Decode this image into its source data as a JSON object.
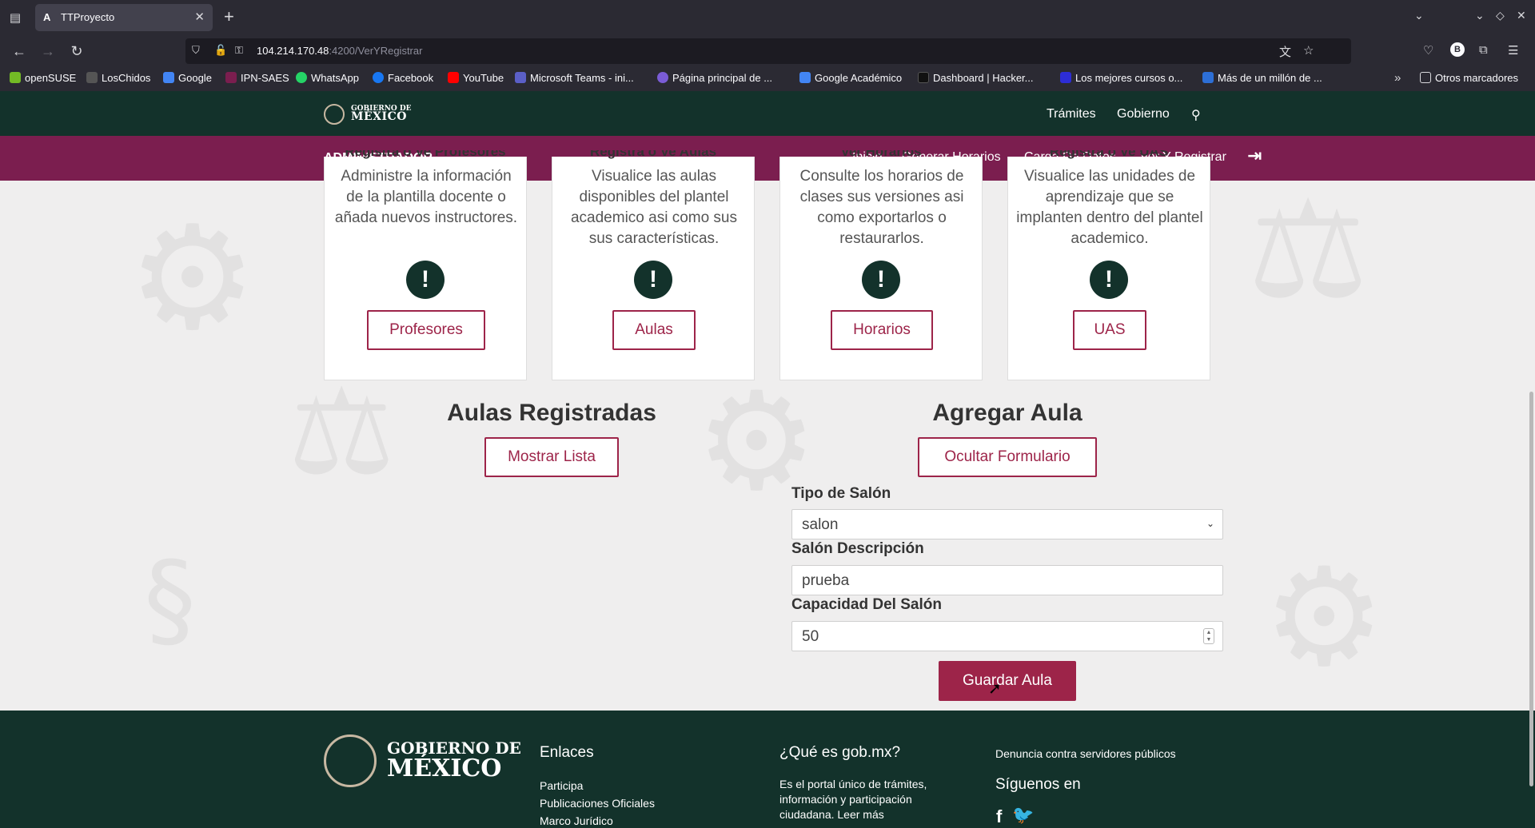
{
  "browser": {
    "tab_title": "TTProyecto",
    "tab_favicon": "A",
    "url_host": "104.214.170.48",
    "url_path": ":4200/VerYRegistrar",
    "bookmarks": [
      {
        "label": "openSUSE",
        "color": "#73ba25"
      },
      {
        "label": "LosChidos",
        "color": "#555555"
      },
      {
        "label": "Google",
        "color": "#4285f4"
      },
      {
        "label": "IPN-SAES",
        "color": "#7b1e4f"
      },
      {
        "label": "WhatsApp",
        "color": "#25d366"
      },
      {
        "label": "Facebook",
        "color": "#1877f2"
      },
      {
        "label": "YouTube",
        "color": "#ff0000"
      },
      {
        "label": "Microsoft Teams - ini...",
        "color": "#5b5fc7"
      },
      {
        "label": "Página principal de ...",
        "color": "#7a5cd6"
      },
      {
        "label": "Google Académico",
        "color": "#4285f4"
      },
      {
        "label": "Dashboard | Hacker...",
        "color": "#111111"
      },
      {
        "label": "Los mejores cursos o...",
        "color": "#2d2dd6"
      },
      {
        "label": "Más de un millón de ...",
        "color": "#2d6fd6"
      }
    ],
    "other_bookmarks": "Otros marcadores"
  },
  "gov_header": {
    "logo_small": "GOBIERNO DE",
    "logo_big": "MÉXICO",
    "nav": [
      "Trámites",
      "Gobierno"
    ]
  },
  "admin_bar": {
    "title": "ADMINISTRADOR",
    "nav": [
      "Inicio",
      "Generar Horarios",
      "Carga De Datos",
      "Ver Y Registrar"
    ]
  },
  "cards": [
    {
      "title": "Registra o Ve Profesores",
      "text": "Administre la información de la plantilla docente o añada nuevos instructores.",
      "button": "Profesores"
    },
    {
      "title": "Registra o Ve Aulas",
      "text": "Visualice las aulas disponibles del plantel academico asi como sus sus características.",
      "button": "Aulas"
    },
    {
      "title": "Ver Horarios",
      "text": "Consulte los horarios de clases sus versiones asi como exportarlos o restaurarlos.",
      "button": "Horarios"
    },
    {
      "title": "Registra o Ve UAS",
      "text": "Visualice las unidades de aprendizaje que se implanten dentro del plantel academico.",
      "button": "UAS"
    }
  ],
  "registered": {
    "title": "Aulas Registradas",
    "button": "Mostrar Lista"
  },
  "add_form": {
    "title": "Agregar Aula",
    "toggle_button": "Ocultar Formulario",
    "type_label": "Tipo de Salón",
    "type_value": "salon",
    "desc_label": "Salón Descripción",
    "desc_value": "prueba",
    "capacity_label": "Capacidad Del Salón",
    "capacity_value": "50",
    "submit": "Guardar Aula"
  },
  "footer": {
    "logo_small": "GOBIERNO DE",
    "logo_big": "MÉXICO",
    "links_title": "Enlaces",
    "links": [
      "Participa",
      "Publicaciones Oficiales",
      "Marco Jurídico"
    ],
    "about_title": "¿Qué es gob.mx?",
    "about_text": "Es el portal único de trámites, información y participación ciudadana. Leer más",
    "report": "Denuncia contra servidores públicos",
    "follow": "Síguenos en",
    "social": [
      "f",
      "t"
    ]
  }
}
